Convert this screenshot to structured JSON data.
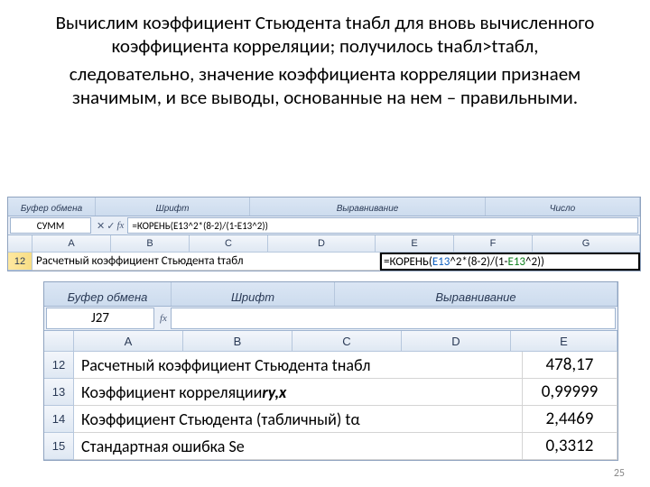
{
  "text": {
    "p1": "Вычислим коэффициент Стьюдента tнабл для вновь вычисленного коэффициента корреляции; получилось tнабл>tтабл,",
    "p2": "следовательно, значение коэффициента корреляции признаем значимым, и все выводы, основанные на нем – правильными."
  },
  "ribbon": {
    "g1": "Буфер обмена",
    "g2": "Шрифт",
    "g3": "Выравнивание",
    "g4": "Число"
  },
  "strip1": {
    "namebox": "СУММ",
    "formula": "=КОРЕНЬ(E13^2*(8-2)/(1-E13^2))",
    "edit_prefix": "=КОРЕНЬ(",
    "edit_ref1": "E13",
    "edit_mid1": "^2*(8-2)/(1-",
    "edit_ref2": "E13",
    "edit_mid2": "^2))",
    "cols": [
      "A",
      "B",
      "C",
      "D",
      "E",
      "F",
      "G"
    ],
    "row": "12",
    "label": "Расчетный коэффициент Стьюдента tтабл"
  },
  "strip2": {
    "namebox": "J27",
    "cols": [
      "A",
      "B",
      "C",
      "D",
      "E"
    ],
    "rows": [
      {
        "n": "12",
        "label": "Расчетный коэффициент Стьюдента tнабл",
        "val": "478,17"
      },
      {
        "n": "13",
        "label_html": "Коэффициент корреляции <span class='bold-ital'>ry,x</span>",
        "val": "0,99999"
      },
      {
        "n": "14",
        "label": "Коэффициент Стьюдента (табличный) tα",
        "val": "2,4469"
      },
      {
        "n": "15",
        "label": "Стандартная ошибка Se",
        "val": "0,3312"
      }
    ]
  },
  "page": "25"
}
